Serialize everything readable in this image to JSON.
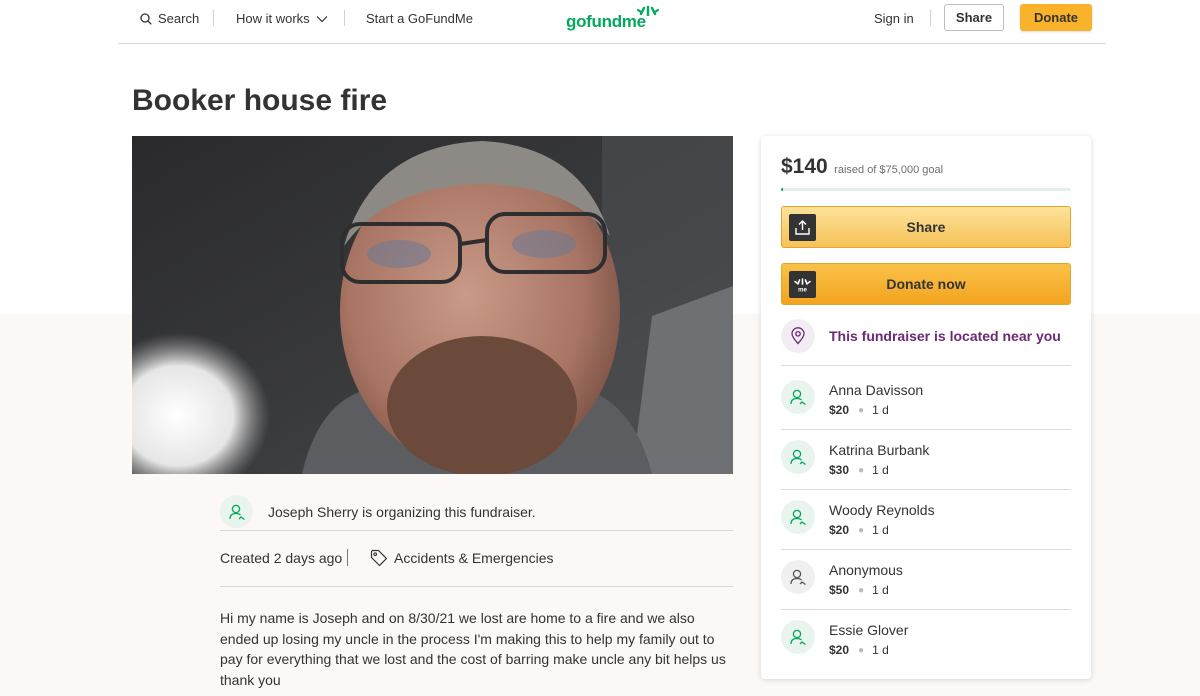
{
  "header": {
    "search_label": "Search",
    "how_it_works_label": "How it works",
    "start_label": "Start a GoFundMe",
    "logo_text": "gofundme",
    "sign_in_label": "Sign in",
    "share_label": "Share",
    "donate_label": "Donate"
  },
  "campaign": {
    "title": "Booker house fire",
    "organizer_text": "Joseph Sherry is organizing this fundraiser.",
    "created_text": "Created 2 days ago",
    "category": "Accidents & Emergencies",
    "story": "Hi my name is Joseph and on 8/30/21 we lost are home to a fire and we also ended up losing my uncle in the process I'm making this to help my family out to pay for everything that we lost and the cost of barring make uncle any bit helps us thank you"
  },
  "donation_card": {
    "raised_amount": "$140",
    "goal_text": "raised of $75,000 goal",
    "progress_fraction": 0.0019,
    "share_label": "Share",
    "donate_label": "Donate now",
    "location_text": "This fundraiser is located near you",
    "donors": [
      {
        "name": "Anna Davisson",
        "amount": "$20",
        "time": "1 d"
      },
      {
        "name": "Katrina Burbank",
        "amount": "$30",
        "time": "1 d"
      },
      {
        "name": "Woody Reynolds",
        "amount": "$20",
        "time": "1 d"
      },
      {
        "name": "Anonymous",
        "amount": "$50",
        "time": "1 d"
      },
      {
        "name": "Essie Glover",
        "amount": "$20",
        "time": "1 d"
      }
    ]
  },
  "colors": {
    "brand_green": "#02a95c",
    "donate_orange": "#f8b32a",
    "location_purple": "#6b2a75"
  }
}
